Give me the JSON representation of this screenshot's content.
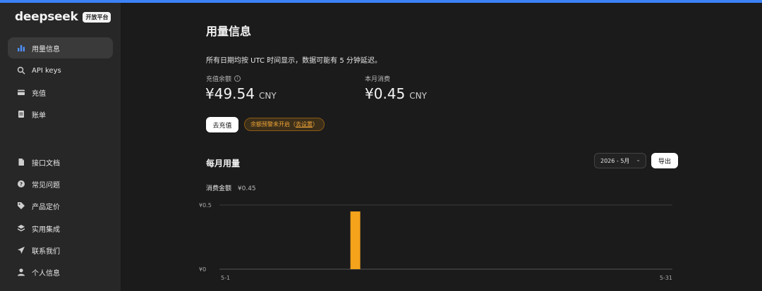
{
  "brand": {
    "name": "deepseek",
    "badge": "开放平台",
    "accent": "#3b82f6"
  },
  "sidebar": {
    "primary": [
      {
        "label": "用量信息",
        "icon": "bar-chart-icon",
        "active": true
      },
      {
        "label": "API keys",
        "icon": "search-icon"
      },
      {
        "label": "充值",
        "icon": "wallet-icon"
      },
      {
        "label": "账单",
        "icon": "receipt-icon"
      }
    ],
    "secondary": [
      {
        "label": "接口文档",
        "icon": "document-icon"
      },
      {
        "label": "常见问题",
        "icon": "help-icon"
      },
      {
        "label": "产品定价",
        "icon": "tag-icon"
      },
      {
        "label": "实用集成",
        "icon": "layers-icon"
      },
      {
        "label": "联系我们",
        "icon": "send-icon"
      },
      {
        "label": "个人信息",
        "icon": "user-icon"
      }
    ]
  },
  "main": {
    "title": "用量信息",
    "note": "所有日期均按 UTC 时间显示，数据可能有 5 分钟延迟。",
    "balance": {
      "label": "充值余额",
      "value": "¥49.54",
      "unit": "CNY"
    },
    "monthly": {
      "label": "本月消费",
      "value": "¥0.45",
      "unit": "CNY"
    },
    "topup_button": "去充值",
    "alert": {
      "text": "余额预警未开启（",
      "link": "去设置",
      "suffix": "）",
      "color": "#f1a637"
    },
    "usage": {
      "title": "每月用量",
      "month_select": "2026 - 5月",
      "export_button": "导出",
      "metric_label": "消费金额",
      "metric_value": "¥0.45"
    }
  },
  "chart_data": {
    "type": "bar",
    "bar_color": "#f5a31a",
    "x_start_label": "5-1",
    "x_end_label": "5-31",
    "y_tick_labels": [
      "¥0",
      "¥0.5"
    ],
    "ylim": [
      0,
      0.5
    ],
    "days": 31,
    "points": [
      {
        "day": 10,
        "value": 0.45
      }
    ]
  }
}
